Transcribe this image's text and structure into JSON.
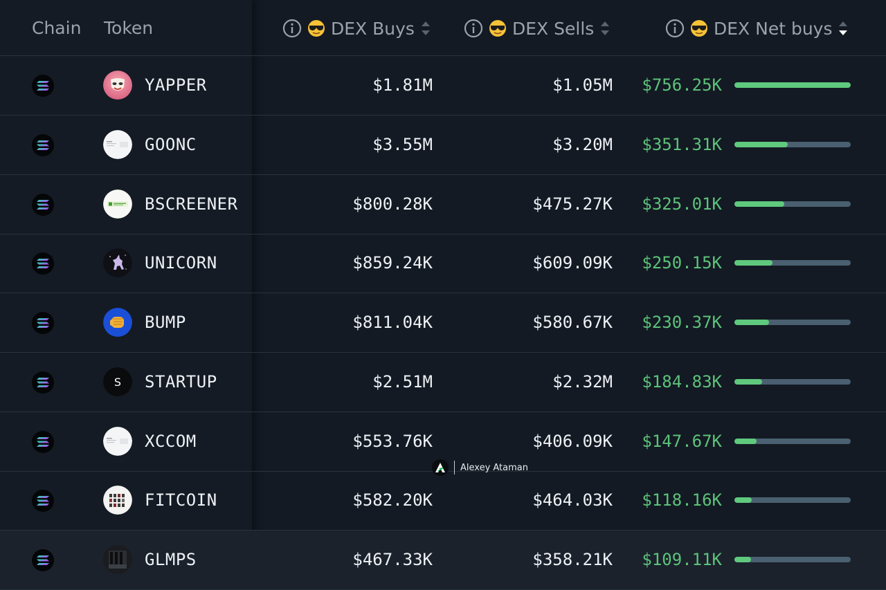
{
  "header": {
    "chain_label": "Chain",
    "token_label": "Token",
    "buys_label": "DEX Buys",
    "sells_label": "DEX Sells",
    "net_label": "DEX Net buys"
  },
  "colors": {
    "positive": "#5dc27a",
    "bar_track": "#4a6071",
    "background": "#131a23"
  },
  "rows": [
    {
      "token": "YAPPER",
      "buys": "$1.81M",
      "sells": "$1.05M",
      "net": "$756.25K",
      "net_ratio": 1.0,
      "chain_icon": "solana-icon",
      "avatar_icon": "pink-mask-avatar"
    },
    {
      "token": "GOONC",
      "buys": "$3.55M",
      "sells": "$3.20M",
      "net": "$351.31K",
      "net_ratio": 0.46,
      "chain_icon": "solana-icon",
      "avatar_icon": "white-screenshot-avatar"
    },
    {
      "token": "BSCREENER",
      "buys": "$800.28K",
      "sells": "$475.27K",
      "net": "$325.01K",
      "net_ratio": 0.43,
      "chain_icon": "solana-icon",
      "avatar_icon": "green-logo-avatar"
    },
    {
      "token": "UNICORN",
      "buys": "$859.24K",
      "sells": "$609.09K",
      "net": "$250.15K",
      "net_ratio": 0.33,
      "chain_icon": "solana-icon",
      "avatar_icon": "unicorn-avatar"
    },
    {
      "token": "BUMP",
      "buys": "$811.04K",
      "sells": "$580.67K",
      "net": "$230.37K",
      "net_ratio": 0.3,
      "chain_icon": "solana-icon",
      "avatar_icon": "fist-bump-avatar"
    },
    {
      "token": "STARTUP",
      "buys": "$2.51M",
      "sells": "$2.32M",
      "net": "$184.83K",
      "net_ratio": 0.24,
      "chain_icon": "solana-icon",
      "avatar_icon": "letter-s-avatar",
      "avatar_letter": "S"
    },
    {
      "token": "XCCOM",
      "buys": "$553.76K",
      "sells": "$406.09K",
      "net": "$147.67K",
      "net_ratio": 0.19,
      "chain_icon": "solana-icon",
      "avatar_icon": "white-screenshot-avatar"
    },
    {
      "token": "FITCOIN",
      "buys": "$582.20K",
      "sells": "$464.03K",
      "net": "$118.16K",
      "net_ratio": 0.15,
      "chain_icon": "solana-icon",
      "avatar_icon": "icon-grid-avatar"
    },
    {
      "token": "GLMPS",
      "buys": "$467.33K",
      "sells": "$358.21K",
      "net": "$109.11K",
      "net_ratio": 0.14,
      "chain_icon": "solana-icon",
      "avatar_icon": "dark-photo-avatar"
    }
  ],
  "watermark": {
    "text": "Alexey Ataman"
  }
}
